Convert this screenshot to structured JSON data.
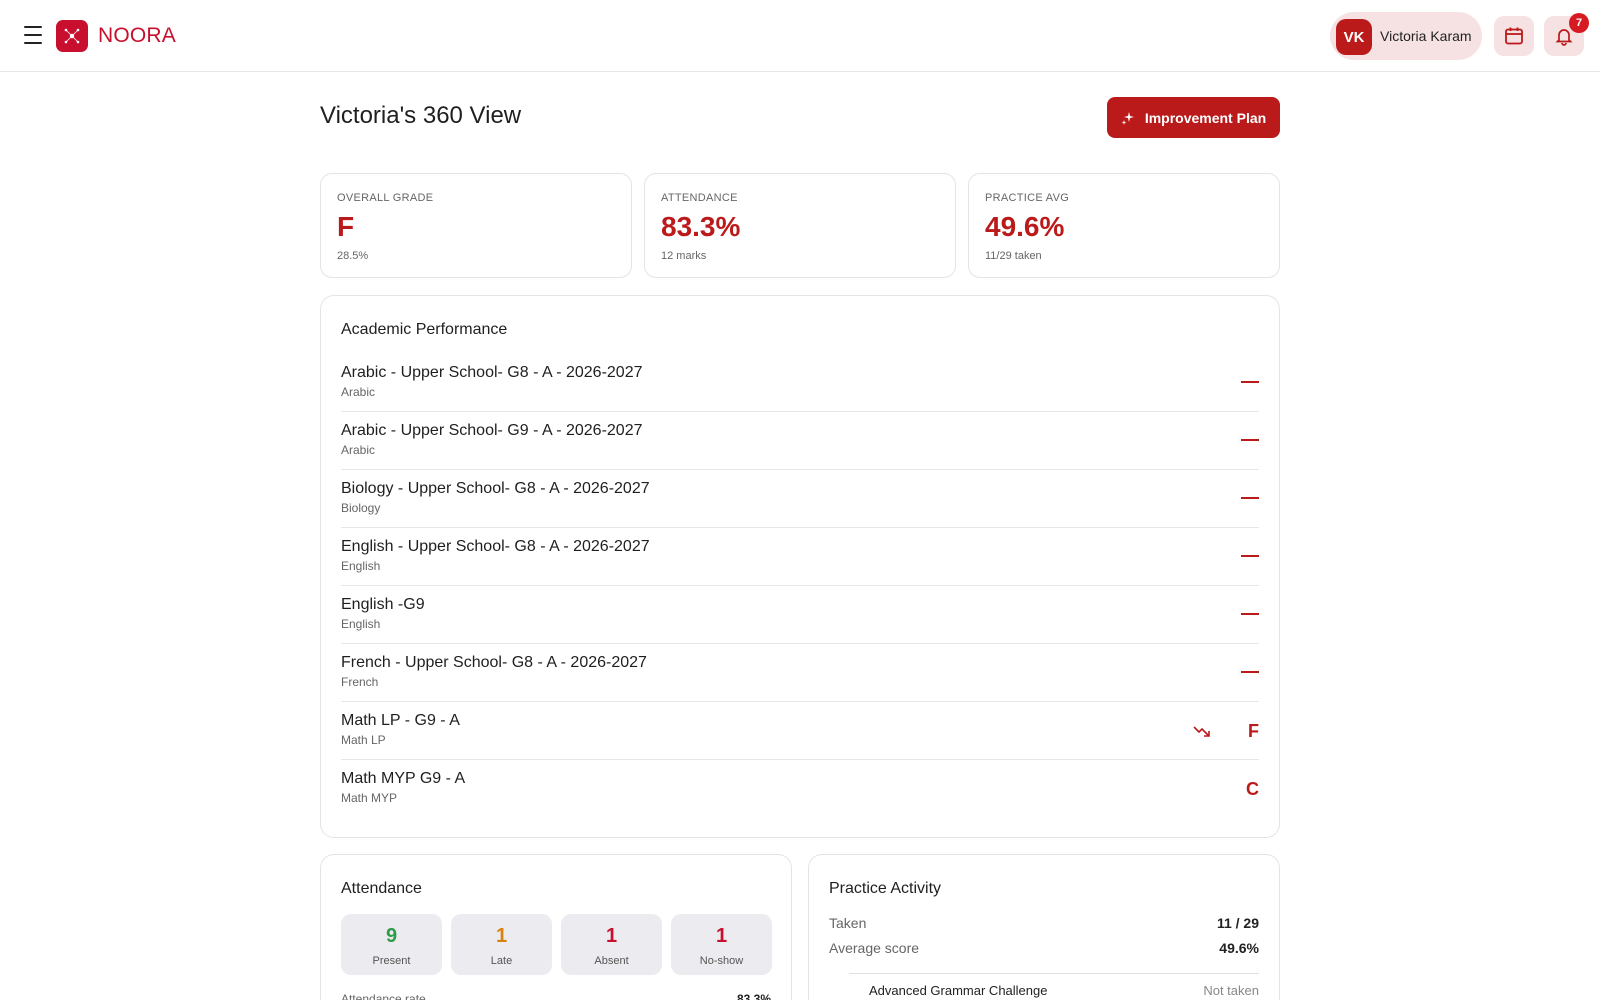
{
  "app": {
    "logo_text": "NOORA",
    "brand_color": "#c8102e"
  },
  "header": {
    "user": {
      "initials": "VK",
      "name": "Victoria Karam"
    },
    "notifications_count": "7",
    "icons": [
      "menu-icon",
      "calendar-icon",
      "bell-icon"
    ]
  },
  "page": {
    "title": "Victoria's 360 View",
    "improvement_button": "Improvement Plan"
  },
  "stats": [
    {
      "label": "OVERALL GRADE",
      "value": "F",
      "sub": "28.5%"
    },
    {
      "label": "ATTENDANCE",
      "value": "83.3%",
      "sub": "12 marks"
    },
    {
      "label": "PRACTICE AVG",
      "value": "49.6%",
      "sub": "11/29 taken"
    }
  ],
  "academic": {
    "title": "Academic Performance",
    "courses": [
      {
        "name": "Arabic - Upper School- G8 - A - 2026-2027",
        "subject": "Arabic",
        "grade": "",
        "trend": ""
      },
      {
        "name": "Arabic - Upper School- G9 - A - 2026-2027",
        "subject": "Arabic",
        "grade": "",
        "trend": ""
      },
      {
        "name": "Biology - Upper School- G8 - A - 2026-2027",
        "subject": "Biology",
        "grade": "",
        "trend": ""
      },
      {
        "name": "English - Upper School- G8 - A - 2026-2027",
        "subject": "English",
        "grade": "",
        "trend": ""
      },
      {
        "name": "English -G9",
        "subject": "English",
        "grade": "",
        "trend": ""
      },
      {
        "name": "French - Upper School- G8 - A - 2026-2027",
        "subject": "French",
        "grade": "",
        "trend": ""
      },
      {
        "name": "Math LP - G9 - A",
        "subject": "Math LP",
        "grade": "F",
        "trend": "down"
      },
      {
        "name": "Math MYP G9 - A",
        "subject": "Math MYP",
        "grade": "C",
        "trend": ""
      }
    ]
  },
  "attendance": {
    "title": "Attendance",
    "tiles": [
      {
        "value": "9",
        "label": "Present",
        "color": "#2e9b4a"
      },
      {
        "value": "1",
        "label": "Late",
        "color": "#d9820f"
      },
      {
        "value": "1",
        "label": "Absent",
        "color": "#c8102e"
      },
      {
        "value": "1",
        "label": "No-show",
        "color": "#c8102e"
      }
    ],
    "rate_label": "Attendance rate",
    "rate_value": "83.3%"
  },
  "practice": {
    "title": "Practice Activity",
    "taken_label": "Taken",
    "taken_value": "11 / 29",
    "avg_label": "Average score",
    "avg_value": "49.6%",
    "items": [
      {
        "name": "Advanced Grammar Challenge",
        "status": "Not taken"
      }
    ]
  }
}
